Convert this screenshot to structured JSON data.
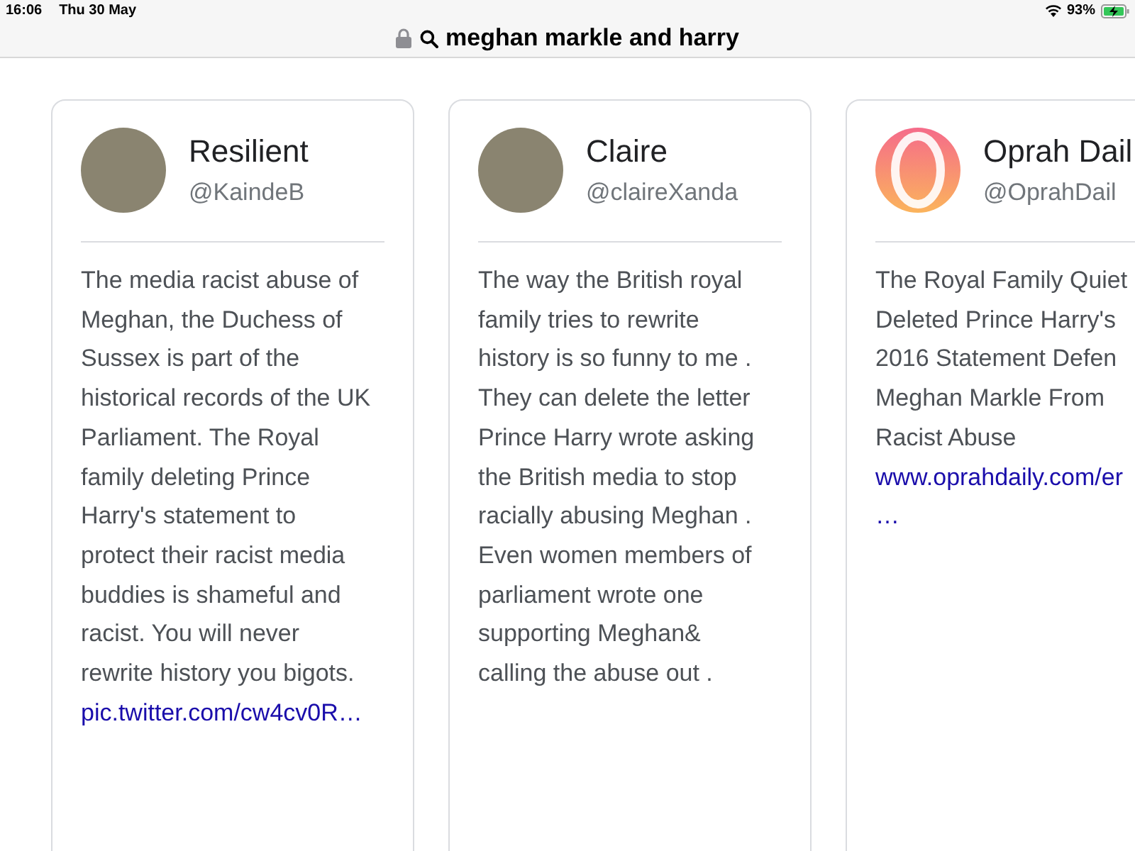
{
  "status_bar": {
    "time": "16:06",
    "date": "Thu 30 May",
    "battery": "93%"
  },
  "address_bar": {
    "query": "meghan markle and harry"
  },
  "cards": [
    {
      "name": "Resilient",
      "handle": "@KaindeB",
      "avatar": {
        "kind": "photo"
      },
      "lines": [
        "The media racist abuse of",
        "Meghan, the Duchess of",
        "Sussex is part of the",
        "historical records of the UK",
        "Parliament. The Royal",
        "family deleting Prince",
        "Harry's statement to",
        "protect their racist media",
        "buddies is shameful and",
        "racist. You will never",
        "rewrite history you bigots."
      ],
      "link": "pic.twitter.com/cw4cv0R…"
    },
    {
      "name": "Claire",
      "handle": "@claireXanda",
      "avatar": {
        "kind": "photo"
      },
      "lines": [
        "The way the British royal",
        "family tries to rewrite",
        "history is so funny to me .",
        "They can delete the letter",
        "Prince Harry wrote asking",
        "the British media to stop",
        "racially abusing Meghan .",
        "Even women members of",
        "parliament wrote one",
        "supporting Meghan&",
        "calling the abuse out ."
      ]
    },
    {
      "name": "Oprah Dail",
      "handle": "@OprahDail",
      "avatar": {
        "kind": "logo"
      },
      "lines": [
        "The Royal Family Quiet",
        "Deleted Prince Harry's",
        "2016 Statement Defen",
        "Meghan Markle From",
        "Racist Abuse"
      ],
      "link": "www.oprahdaily.com/er",
      "more": "…"
    }
  ]
}
